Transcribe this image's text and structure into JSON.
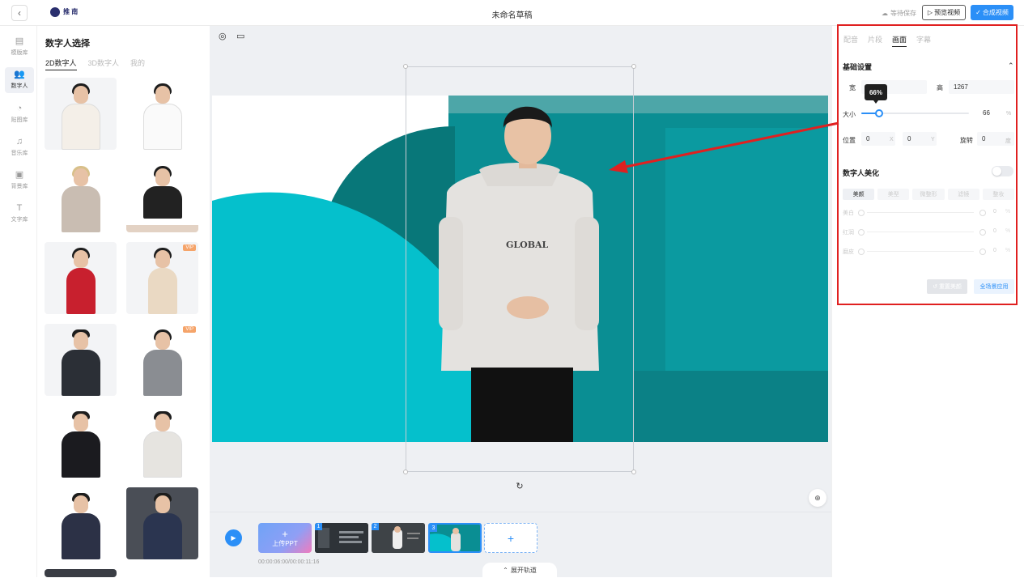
{
  "topbar": {
    "back_icon": "‹",
    "logo_text": "推 南",
    "title": "未命名草稿",
    "save_state": "等待保存",
    "preview_label": "预览视频",
    "compose_label": "合成视频"
  },
  "nav": [
    {
      "icon": "▤",
      "label": "模版库"
    },
    {
      "icon": "👥",
      "label": "数字人"
    },
    {
      "icon": "◔",
      "label": "贴图库"
    },
    {
      "icon": "♫",
      "label": "音乐库"
    },
    {
      "icon": "▣",
      "label": "背景库"
    },
    {
      "icon": "T",
      "label": "文字库"
    }
  ],
  "panel": {
    "title": "数字人选择",
    "tabs": [
      "2D数字人",
      "3D数字人",
      "我的"
    ],
    "vip_badge": "VIP"
  },
  "canvas": {
    "play_glyph": "▶",
    "rotate_glyph": "↻",
    "zoom_glyph": "⊕"
  },
  "timeline": {
    "upload_plus": "+",
    "upload_label": "上传PPT",
    "clips": [
      "1",
      "2",
      "3"
    ],
    "add_glyph": "+",
    "time": "00:00:06:00/00:00:11:16",
    "expand_label": "展开轨道"
  },
  "right": {
    "tabs": [
      "配音",
      "片段",
      "画面",
      "字幕"
    ],
    "basic_title": "基础设置",
    "width_label": "宽",
    "height_label": "高",
    "height_value": "1267",
    "size_label": "大小",
    "size_value": "66",
    "size_unit": "%",
    "size_tooltip": "66%",
    "size_fraction": 0.66,
    "position_label": "位置",
    "pos_x": "0",
    "x_label": "X",
    "pos_y": "0",
    "y_label": "Y",
    "rotate_label": "旋转",
    "rotate_value": "0",
    "rotate_unit": "度",
    "beauty_title": "数字人美化",
    "beauty_tabs": [
      "美颜",
      "美型",
      "微整形",
      "滤镜",
      "整妆"
    ],
    "beauty_rows": [
      {
        "label": "美白",
        "value": "0",
        "unit": "%"
      },
      {
        "label": "红润",
        "value": "0",
        "unit": "%"
      },
      {
        "label": "磨皮",
        "value": "0",
        "unit": "%"
      }
    ],
    "reset_label": "重置美颜",
    "apply_label": "全场景应用"
  },
  "colors": {
    "accent": "#2b8ff7",
    "highlight": "#e02020",
    "teal": "#05c0cc"
  }
}
